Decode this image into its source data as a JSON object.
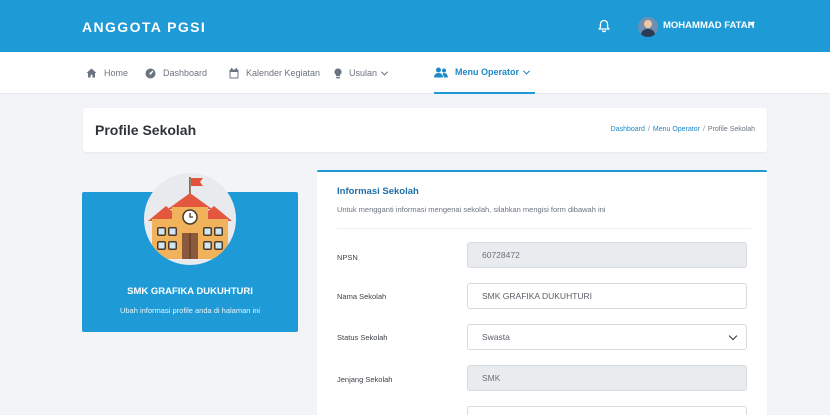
{
  "app": {
    "brand": "ANGGOTA PGSI"
  },
  "user": {
    "name": "MOHAMMAD FATAH"
  },
  "nav": {
    "home": "Home",
    "dashboard": "Dashboard",
    "kalender": "Kalender Kegiatan",
    "usulan": "Usulan",
    "menu_operator": "Menu Operator"
  },
  "header": {
    "title": "Profile Sekolah",
    "breadcrumb": [
      "Dashboard",
      "Menu Operator",
      "Profile Sekolah"
    ],
    "sep": "/"
  },
  "profile": {
    "school_name": "SMK GRAFIKA DUKUHTURI",
    "subtitle": "Ubah informasi profile anda di halaman ini"
  },
  "info": {
    "title": "Informasi Sekolah",
    "description": "Untuk mengganti informasi mengenai sekolah, silahkan mengisi form dibawah ini",
    "fields": {
      "npsn": {
        "label": "NPSN",
        "value": "60728472"
      },
      "nama": {
        "label": "Nama Sekolah",
        "value": "SMK GRAFIKA DUKUHTURI"
      },
      "status": {
        "label": "Status Sekolah",
        "value": "Swasta"
      },
      "jenjang": {
        "label": "Jenjang Sekolah",
        "value": "SMK"
      }
    }
  },
  "colors": {
    "primary": "#1e9ad6",
    "active_nav": "#1e88c7"
  }
}
